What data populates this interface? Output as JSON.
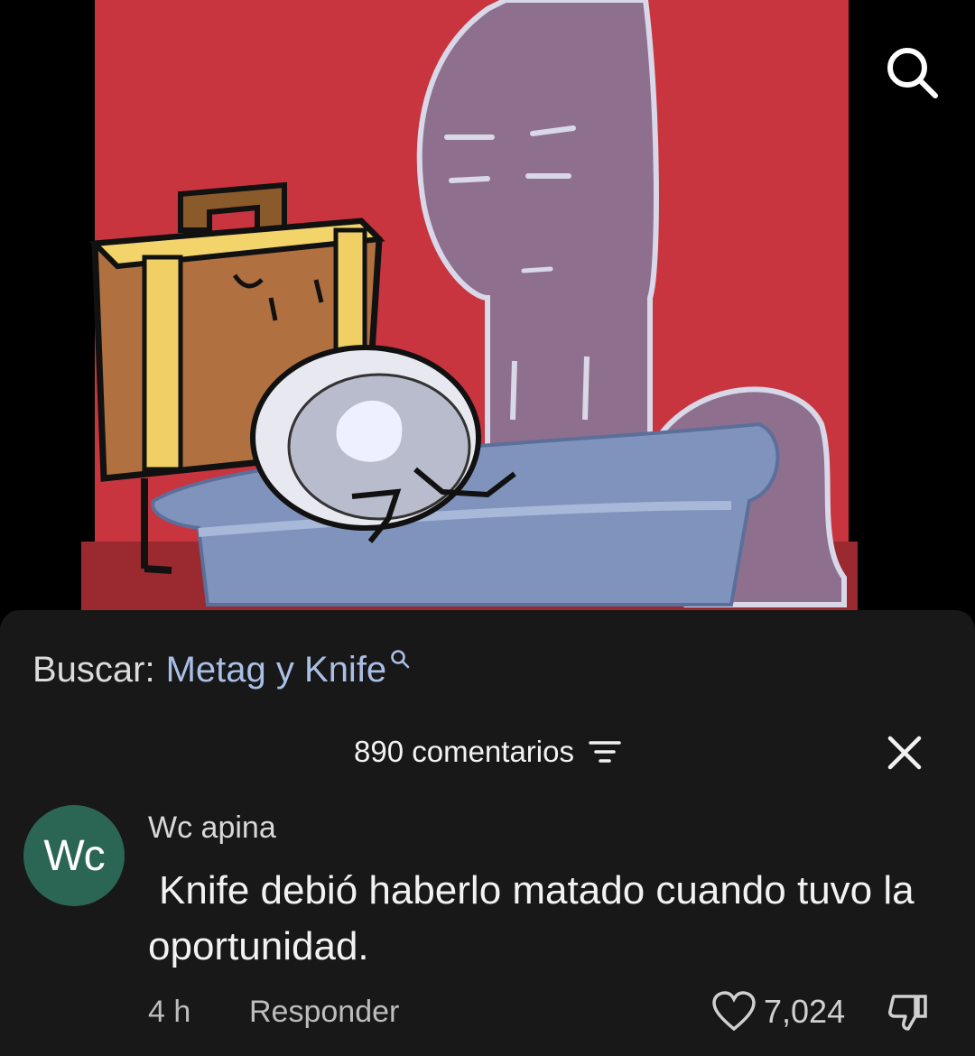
{
  "header": {
    "search_icon": "search-icon"
  },
  "search_suggestion": {
    "prefix": "Buscar:",
    "query": "Metag y Knife",
    "icon": "search-icon"
  },
  "comments_panel": {
    "count_label": "890 comentarios",
    "sort_icon": "sort-icon",
    "close_icon": "close-icon"
  },
  "comment": {
    "avatar_initials": "Wc",
    "avatar_color": "#2b6655",
    "username": "Wc apina",
    "text": "Knife debió haberlo matado cuando tuvo la oportunidad.",
    "time": "4 h",
    "reply_label": "Responder",
    "likes": "7,024",
    "like_icon": "heart-icon",
    "dislike_icon": "thumbs-down-icon"
  }
}
